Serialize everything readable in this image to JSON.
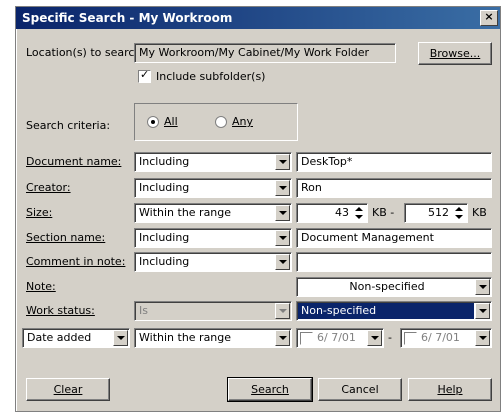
{
  "window": {
    "title": "Specific Search - My Workroom",
    "close": "×"
  },
  "location": {
    "label": "Location(s) to search:",
    "value": "My Workroom/My Cabinet/My Work Folder",
    "browse_label": "Browse...",
    "include_subfolders_label": "Include subfolder(s)",
    "include_subfolders": true
  },
  "criteria": {
    "label": "Search criteria:",
    "options": [
      "All",
      "Any"
    ],
    "selected": "All"
  },
  "rows": {
    "document_name": {
      "label": "Document name:",
      "op": "Including",
      "value": "DeskTop*"
    },
    "creator": {
      "label": "Creator:",
      "op": "Including",
      "value": "Ron"
    },
    "size": {
      "label": "Size:",
      "op": "Within the range",
      "min": "43",
      "max": "512",
      "unit_min": "KB -",
      "unit_max": "KB"
    },
    "section_name": {
      "label": "Section name:",
      "op": "Including",
      "value": "Document Management"
    },
    "comment": {
      "label": "Comment in note:",
      "op": "Including",
      "value": ""
    },
    "note": {
      "label": "Note:",
      "value": "Non-specified"
    },
    "work_status": {
      "label": "Work status:",
      "op": "Is",
      "value": "Non-specified"
    },
    "date": {
      "field": "Date added",
      "op": "Within the range",
      "from": "6/ 7/01",
      "to": "6/ 7/01",
      "sep": "-"
    }
  },
  "buttons": {
    "clear": "Clear",
    "search": "Search",
    "cancel": "Cancel",
    "help": "Help"
  }
}
